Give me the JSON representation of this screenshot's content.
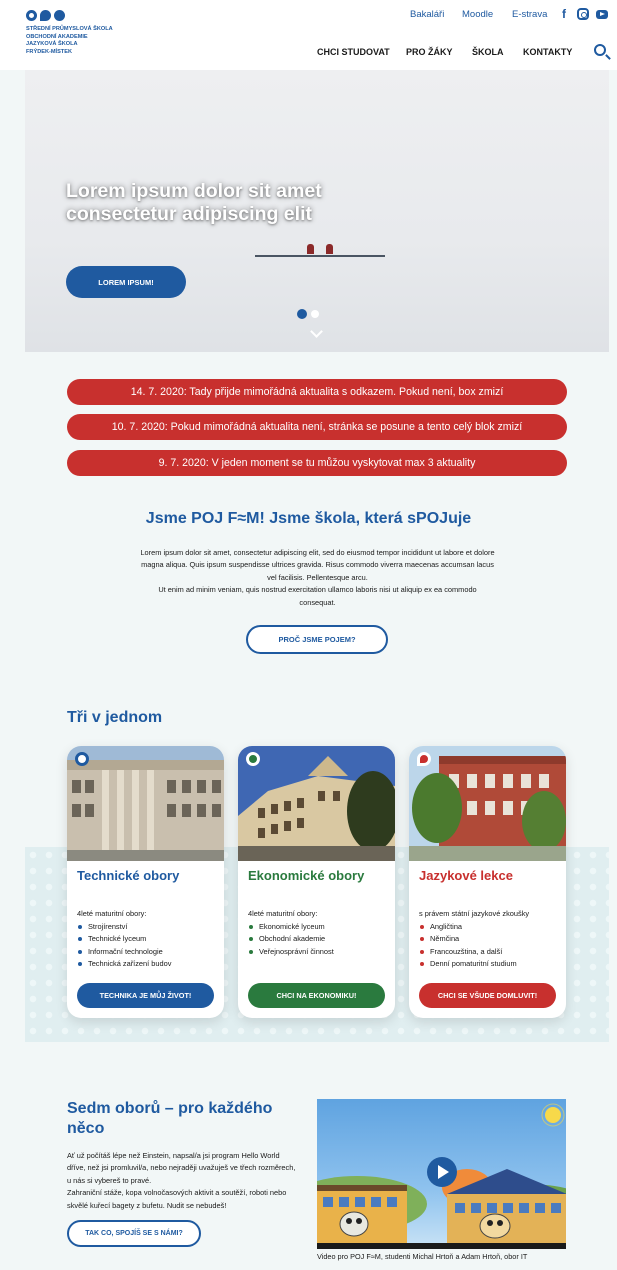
{
  "header": {
    "logo_lines": [
      "STŘEDNÍ PRŮMYSLOVÁ ŠKOLA",
      "OBCHODNÍ AKADEMIE",
      "JAZYKOVÁ ŠKOLA",
      "FRÝDEK-MÍSTEK"
    ],
    "top_links": [
      "Bakaláři",
      "Moodle",
      "E-strava"
    ],
    "social_icons": [
      "facebook-icon",
      "instagram-icon",
      "youtube-icon"
    ],
    "nav": [
      "CHCI STUDOVAT",
      "PRO ŽÁKY",
      "ŠKOLA",
      "KONTAKTY"
    ],
    "accent_color": "#1f5aa0"
  },
  "hero": {
    "title": "Lorem ipsum dolor sit amet consectetur adipiscing elit",
    "button": "LOREM IPSUM!",
    "slides_total": 2,
    "slide_active": 1
  },
  "alerts": {
    "color": "#c8302e",
    "items": [
      "14. 7. 2020: Tady přijde mimořádná aktualita s odkazem. Pokud není, box zmizí",
      "10. 7. 2020: Pokud mimořádná aktualita není, stránka se posune a tento celý blok zmizí",
      "9. 7. 2020: V jeden moment se tu můžou vyskytovat max 3 aktuality"
    ]
  },
  "intro": {
    "title": "Jsme POJ F≈M! Jsme škola, která sPOJuje",
    "paragraph1": "Lorem ipsum dolor sit amet, consectetur adipiscing elit, sed do eiusmod tempor incididunt ut labore et dolore magna aliqua. Quis ipsum suspendisse ultrices gravida. Risus commodo viverra maecenas accumsan lacus vel facilisis. Pellentesque arcu.",
    "paragraph2": "Ut enim ad minim veniam, quis nostrud exercitation ullamco laboris nisi ut aliquip ex ea commodo consequat.",
    "button": "PROČ JSME POJEM?"
  },
  "three": {
    "title": "Tři v jednom",
    "cards": [
      {
        "title": "Technické obory",
        "subtitle": "4leté maturitní obory:",
        "items": [
          "Strojírenství",
          "Technické lyceum",
          "Informační technologie",
          "Technická zařízení budov"
        ],
        "button": "TECHNIKA JE MŮJ ŽIVOT!",
        "color": "#1f5aa0"
      },
      {
        "title": "Ekonomické obory",
        "subtitle": "4leté maturitní obory:",
        "items": [
          "Ekonomické lyceum",
          "Obchodní akademie",
          "Veřejnosprávní činnost"
        ],
        "button": "CHCI NA EKONOMIKU!",
        "color": "#2a7a3e"
      },
      {
        "title": "Jazykové lekce",
        "subtitle": "s právem státní jazykové zkoušky",
        "items": [
          "Angličtina",
          "Němčina",
          "Francouzština, a další",
          "Denní pomaturitní studium"
        ],
        "button": "CHCI SE VŠUDE DOMLUVIT!",
        "color": "#c8302e"
      }
    ]
  },
  "seven": {
    "title": "Sedm oborů – pro každého něco",
    "paragraph1": "Ať už počítáš lépe než Einstein, napsal/a jsi program Hello World dříve, než jsi promluvil/a, nebo nejraději uvažuješ ve třech rozměrech, u nás si vybereš to pravé.",
    "paragraph2": "Zahraniční stáže, kopa volnočasových aktivit a soutěží, roboti nebo skvělé kuřecí bagety z bufetu. Nudit se nebudeš!",
    "button": "TAK CO, SPOJÍŠ SE S NÁMI?",
    "video_caption": "Video pro POJ F≈M, studenti Michal Hrtoň a Adam Hrtoň, obor IT"
  }
}
